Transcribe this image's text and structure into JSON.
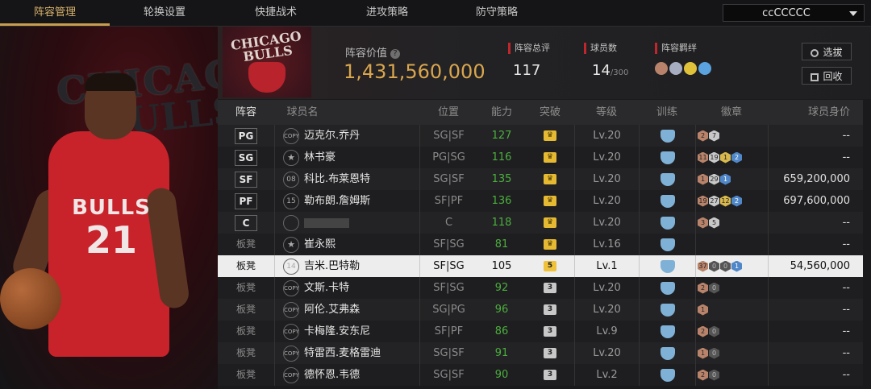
{
  "nav": {
    "tabs": [
      "阵容管理",
      "轮换设置",
      "快捷战术",
      "进攻策略",
      "防守策略"
    ],
    "active_tab": 0,
    "team_select": "ccCCCCC"
  },
  "hero": {
    "logo_text_line1": "CHICAGO",
    "logo_text_line2": "BULLS",
    "jersey_name": "BULLS",
    "jersey_number": "21"
  },
  "header": {
    "team_logo_text": "CHICAGO BULLS",
    "lineup_value_label": "阵容价值",
    "lineup_value": "1,431,560,000",
    "total_rating_label": "阵容总评",
    "total_rating": "117",
    "player_count_label": "球员数",
    "player_count": "14",
    "player_count_max": "/300",
    "chemistry_label": "阵容羁绊",
    "scout_button": "选拔",
    "recycle_button": "回收"
  },
  "table": {
    "columns": [
      "阵容",
      "球员名",
      "位置",
      "能力",
      "突破",
      "等级",
      "训练",
      "徽章",
      "球员身价"
    ],
    "rows": [
      {
        "slot": "PG",
        "starter": true,
        "tag": "COPY",
        "num": "",
        "name": "迈克尔.乔丹",
        "pos": "SG|SF",
        "ability": "127",
        "break": "crown",
        "level": "Lv.20",
        "badges": [
          [
            "bronze",
            "2"
          ],
          [
            "silver",
            "7"
          ]
        ],
        "value": "--"
      },
      {
        "slot": "SG",
        "starter": true,
        "tag": "star",
        "num": "",
        "name": "林书豪",
        "pos": "PG|SG",
        "ability": "116",
        "break": "crown",
        "level": "Lv.20",
        "badges": [
          [
            "bronze",
            "11"
          ],
          [
            "silver",
            "19"
          ],
          [
            "gold",
            "1"
          ],
          [
            "blue",
            "2"
          ]
        ],
        "value": "--"
      },
      {
        "slot": "SF",
        "starter": true,
        "tag": "",
        "num": "08",
        "name": "科比.布莱恩特",
        "pos": "SG|SF",
        "ability": "135",
        "break": "crown",
        "level": "Lv.20",
        "badges": [
          [
            "bronze",
            "1"
          ],
          [
            "silver",
            "29"
          ],
          [
            "blue",
            "1"
          ]
        ],
        "value": "659,200,000"
      },
      {
        "slot": "PF",
        "starter": true,
        "tag": "",
        "num": "15",
        "name": "勒布朗.詹姆斯",
        "pos": "SF|PF",
        "ability": "136",
        "break": "crown",
        "level": "Lv.20",
        "badges": [
          [
            "bronze",
            "19"
          ],
          [
            "silver",
            "27"
          ],
          [
            "gold",
            "12"
          ],
          [
            "blue",
            "2"
          ]
        ],
        "value": "697,600,000"
      },
      {
        "slot": "C",
        "starter": true,
        "tag": "",
        "num": "",
        "name": "",
        "pos": "C",
        "ability": "118",
        "break": "crown",
        "level": "Lv.20",
        "badges": [
          [
            "bronze",
            "3"
          ],
          [
            "silver",
            "5"
          ]
        ],
        "value": "--"
      },
      {
        "slot": "板凳",
        "starter": false,
        "tag": "star",
        "num": "",
        "name": "崔永熙",
        "pos": "SF|SG",
        "ability": "81",
        "break": "crown",
        "level": "Lv.16",
        "badges": [],
        "value": "--"
      },
      {
        "slot": "板凳",
        "starter": false,
        "tag": "",
        "num": "14",
        "name": "吉米.巴特勒",
        "pos": "SF|SG",
        "ability": "105",
        "break": "5",
        "level": "Lv.1",
        "badges": [
          [
            "bronze",
            "37"
          ],
          [
            "dark",
            "0"
          ],
          [
            "dark",
            "0"
          ],
          [
            "blue",
            "1"
          ]
        ],
        "value": "54,560,000",
        "selected": true
      },
      {
        "slot": "板凳",
        "starter": false,
        "tag": "COPY",
        "num": "",
        "name": "文斯.卡特",
        "pos": "SF|SG",
        "ability": "92",
        "break": "3",
        "level": "Lv.20",
        "badges": [
          [
            "bronze",
            "2"
          ],
          [
            "dark",
            "0"
          ]
        ],
        "value": "--"
      },
      {
        "slot": "板凳",
        "starter": false,
        "tag": "COPY",
        "num": "",
        "name": "阿伦.艾弗森",
        "pos": "SG|PG",
        "ability": "96",
        "break": "3",
        "level": "Lv.20",
        "badges": [
          [
            "bronze",
            "1"
          ]
        ],
        "value": "--"
      },
      {
        "slot": "板凳",
        "starter": false,
        "tag": "COPY",
        "num": "",
        "name": "卡梅隆.安东尼",
        "pos": "SF|PF",
        "ability": "86",
        "break": "3",
        "level": "Lv.9",
        "badges": [
          [
            "bronze",
            "2"
          ],
          [
            "dark",
            "0"
          ]
        ],
        "value": "--"
      },
      {
        "slot": "板凳",
        "starter": false,
        "tag": "COPY",
        "num": "",
        "name": "特雷西.麦格雷迪",
        "pos": "SG|SF",
        "ability": "91",
        "break": "3",
        "level": "Lv.20",
        "badges": [
          [
            "bronze",
            "1"
          ],
          [
            "dark",
            "0"
          ]
        ],
        "value": "--"
      },
      {
        "slot": "板凳",
        "starter": false,
        "tag": "COPY",
        "num": "",
        "name": "德怀恩.韦德",
        "pos": "SG|SF",
        "ability": "90",
        "break": "3",
        "level": "Lv.2",
        "badges": [
          [
            "bronze",
            "2"
          ],
          [
            "dark",
            "0"
          ]
        ],
        "value": "--"
      }
    ]
  },
  "colors": {
    "accent": "#c89d4e",
    "value_gold": "#d9a64e",
    "ability_green": "#4caf3e",
    "red_marker": "#c0272d"
  }
}
